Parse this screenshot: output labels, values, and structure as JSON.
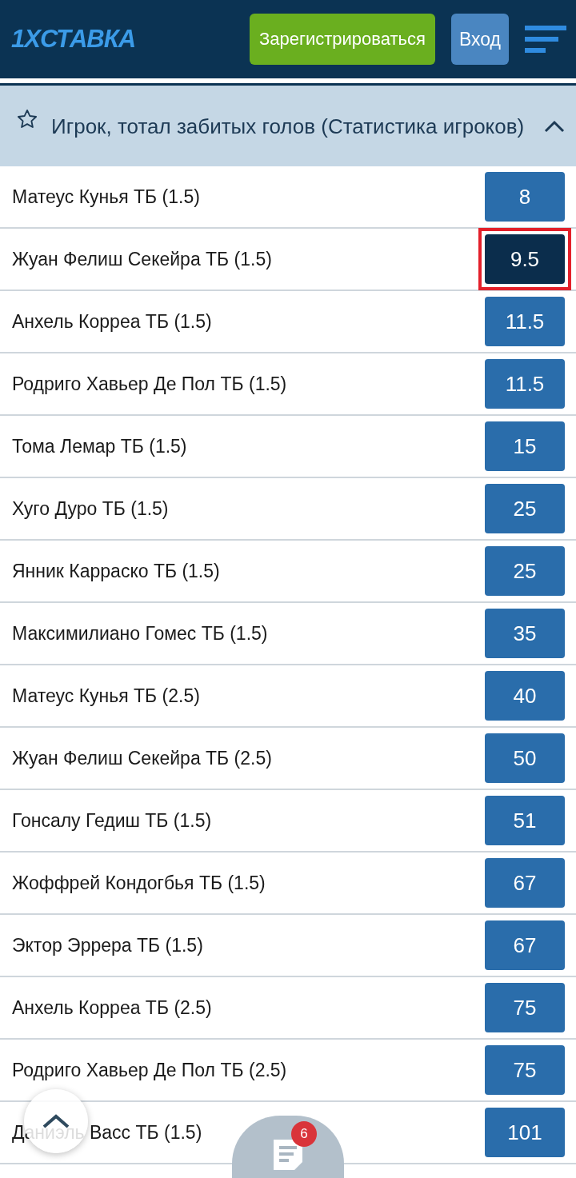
{
  "header": {
    "logo": "1XСТАВКА",
    "register_button": "Зарегистрироваться",
    "login_button": "Вход"
  },
  "section": {
    "title": "Игрок, тотал забитых голов (Статистика игроков)",
    "expanded": true,
    "favorite": false
  },
  "rows": [
    {
      "name": "Матеус Кунья ТБ (1.5)",
      "odds": "8",
      "selected": false,
      "marked": false
    },
    {
      "name": "Жуан Фелиш Секейра ТБ (1.5)",
      "odds": "9.5",
      "selected": true,
      "marked": true
    },
    {
      "name": "Анхель Корреа ТБ (1.5)",
      "odds": "11.5",
      "selected": false,
      "marked": false
    },
    {
      "name": "Родриго Хавьер Де Пол ТБ (1.5)",
      "odds": "11.5",
      "selected": false,
      "marked": false
    },
    {
      "name": "Тома Лемар ТБ (1.5)",
      "odds": "15",
      "selected": false,
      "marked": false
    },
    {
      "name": "Хуго Дуро ТБ (1.5)",
      "odds": "25",
      "selected": false,
      "marked": false
    },
    {
      "name": "Янник Карраско ТБ (1.5)",
      "odds": "25",
      "selected": false,
      "marked": false
    },
    {
      "name": "Максимилиано Гомес ТБ (1.5)",
      "odds": "35",
      "selected": false,
      "marked": false
    },
    {
      "name": "Матеус Кунья ТБ (2.5)",
      "odds": "40",
      "selected": false,
      "marked": false
    },
    {
      "name": "Жуан Фелиш Секейра ТБ (2.5)",
      "odds": "50",
      "selected": false,
      "marked": false
    },
    {
      "name": "Гонсалу Гедиш ТБ (1.5)",
      "odds": "51",
      "selected": false,
      "marked": false
    },
    {
      "name": "Жоффрей Кондогбья ТБ (1.5)",
      "odds": "67",
      "selected": false,
      "marked": false
    },
    {
      "name": "Эктор Эррера ТБ (1.5)",
      "odds": "67",
      "selected": false,
      "marked": false
    },
    {
      "name": "Анхель Корреа ТБ (2.5)",
      "odds": "75",
      "selected": false,
      "marked": false
    },
    {
      "name": "Родриго Хавьер Де Пол ТБ (2.5)",
      "odds": "75",
      "selected": false,
      "marked": false
    },
    {
      "name": "Даниэль Васс ТБ (1.5)",
      "odds": "101",
      "selected": false,
      "marked": false
    }
  ],
  "bet_slip": {
    "badge": "6"
  }
}
